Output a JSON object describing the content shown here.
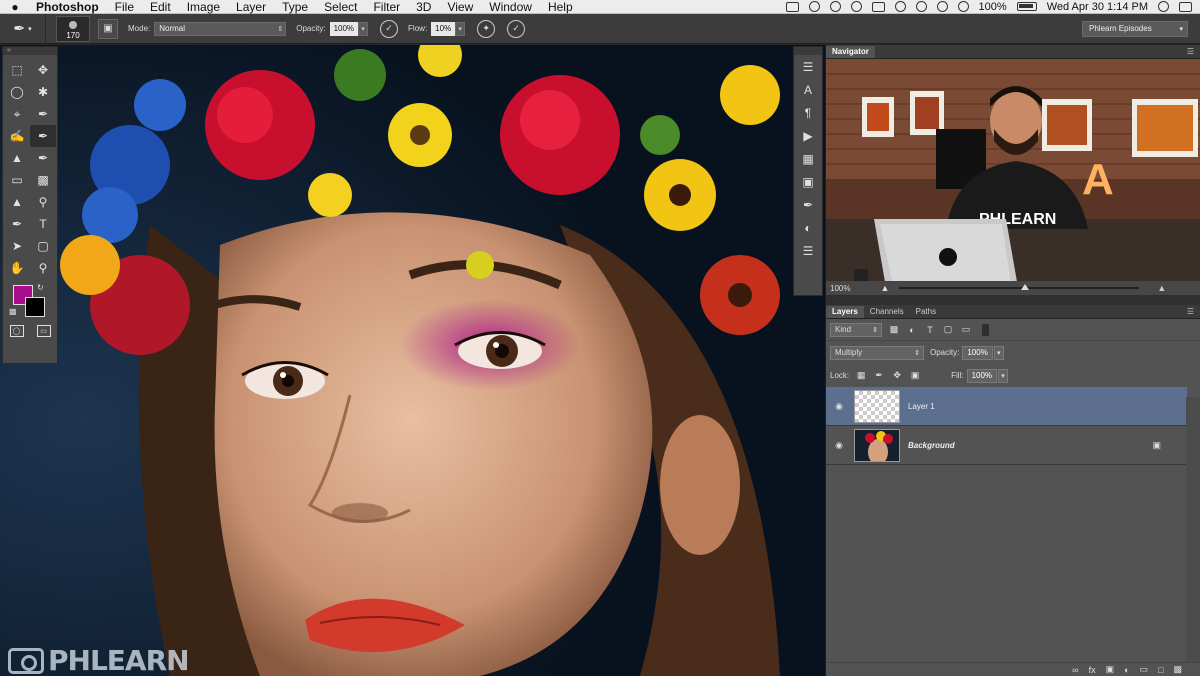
{
  "menubar": {
    "apple": "",
    "app_name": "Photoshop",
    "items": [
      "File",
      "Edit",
      "Image",
      "Layer",
      "Type",
      "Select",
      "Filter",
      "3D",
      "View",
      "Window",
      "Help"
    ],
    "battery": "100%",
    "clock": "Wed Apr 30  1:14 PM"
  },
  "options_bar": {
    "brush_size": "170",
    "mode_label": "Mode:",
    "mode_value": "Normal",
    "opacity_label": "Opacity:",
    "opacity_value": "100%",
    "flow_label": "Flow:",
    "flow_value": "10%",
    "workspace": "Phlearn Episodes"
  },
  "navigator": {
    "tab": "Navigator",
    "zoom": "100%"
  },
  "layers_panel": {
    "tabs": [
      "Layers",
      "Channels",
      "Paths"
    ],
    "filter_kind": "Kind",
    "blend_mode": "Multiply",
    "opacity_label": "Opacity:",
    "opacity_value": "100%",
    "lock_label": "Lock:",
    "fill_label": "Fill:",
    "fill_value": "100%",
    "layers": [
      {
        "name": "Layer 1",
        "selected": true,
        "visible": true
      },
      {
        "name": "Background",
        "selected": false,
        "visible": true,
        "locked": true
      }
    ]
  },
  "foreground_color": "#a80d8a",
  "background_color": "#000000",
  "video_shirt_text": "PHLEARN",
  "watermark": "PHLEARN"
}
